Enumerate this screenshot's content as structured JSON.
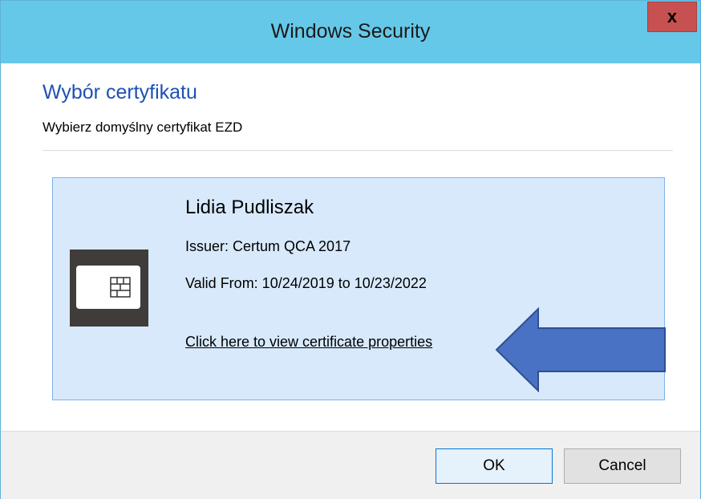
{
  "window": {
    "title": "Windows Security",
    "close_label": "x",
    "accent_color": "#66c8e8"
  },
  "header": {
    "heading": "Wybór certyfikatu",
    "subheading": "Wybierz domyślny certyfikat EZD"
  },
  "certificate": {
    "name": "Lidia Pudliszak",
    "issuer": "Issuer: Certum QCA 2017",
    "valid": "Valid From: 10/24/2019 to 10/23/2022",
    "link": "Click here to view certificate properties",
    "icon": "smart-card-icon",
    "tile_color": "#d8e9fc"
  },
  "annotation": {
    "icon": "left-arrow-icon",
    "color": "#4a72c4"
  },
  "footer": {
    "ok_label": "OK",
    "cancel_label": "Cancel"
  }
}
